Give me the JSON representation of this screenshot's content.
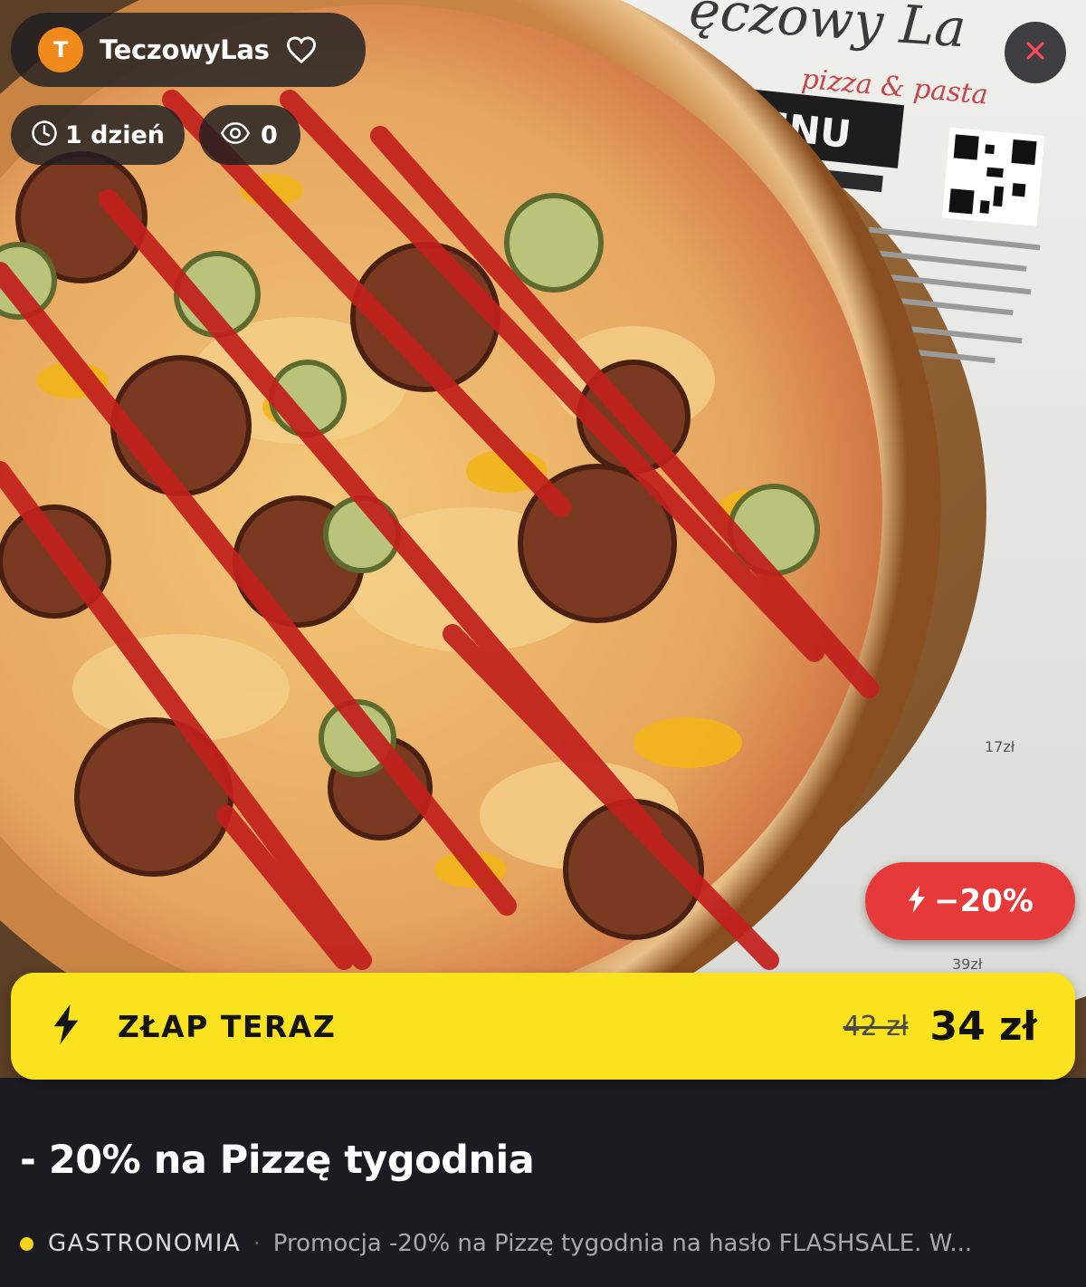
{
  "vendor": {
    "initial": "T",
    "name": "TeczowyLas",
    "brand_color": "#f08a1c"
  },
  "stats": {
    "time_left": "1 dzień",
    "views": "0"
  },
  "photo": {
    "menu_brand_script": "ęczowy La",
    "menu_brand_sub": "pizza & pasta",
    "menu_heading": "MENU",
    "menu_prices": [
      "17zł",
      "39zł"
    ]
  },
  "badge": {
    "discount": "−20%",
    "color": "#e63a3a"
  },
  "cta": {
    "label": "ZŁAP TERAZ",
    "old_price": "42 zł",
    "new_price": "34 zł",
    "color": "#fbe21f"
  },
  "offer": {
    "title": "- 20% na Pizzę tygodnia",
    "category": "GASTRONOMIA",
    "description": "Promocja -20% na Pizzę tygodnia na hasło FLASHSALE. W..."
  },
  "icons": [
    "heart-icon",
    "clock-icon",
    "eye-icon",
    "close-icon",
    "lightning-icon"
  ]
}
